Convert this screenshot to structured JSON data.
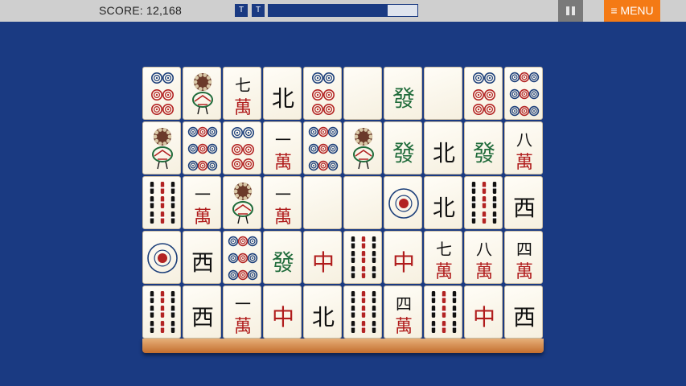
{
  "header": {
    "score_text": "SCORE: 12,168",
    "tool_buttons": [
      "T",
      "T"
    ],
    "progress": 0.8,
    "menu_label": "≡ MENU",
    "accent": "#f47a15",
    "bar_color": "#cfcfcf"
  },
  "board": {
    "background": "#1a3a82",
    "rows": [
      [
        "circle6",
        "bird",
        "char7",
        "north",
        "circle6",
        "blank",
        "green",
        "blank",
        "circle6",
        "circle9"
      ],
      [
        "bird",
        "circle9",
        "circle6",
        "char1",
        "circle9",
        "bird",
        "green",
        "north",
        "green",
        "char8"
      ],
      [
        "bamboo",
        "char1",
        "bird",
        "char1",
        "blank",
        "blank",
        "circle1",
        "north",
        "bamboo",
        "west"
      ],
      [
        "circle1",
        "west",
        "circle9",
        "green",
        "red",
        "bamboo",
        "red",
        "char7",
        "char8",
        "char4"
      ],
      [
        "bamboo",
        "west",
        "char1",
        "red",
        "north",
        "bamboo",
        "char4",
        "bamboo",
        "red",
        "west"
      ]
    ],
    "glyphs": {
      "north": "北",
      "west": "西",
      "red": "中",
      "green": "發",
      "wan": "萬",
      "num1": "一",
      "num4": "四",
      "num7": "七",
      "num8": "八"
    }
  }
}
